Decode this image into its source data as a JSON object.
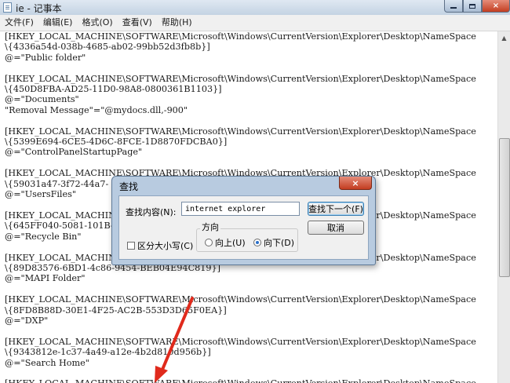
{
  "window": {
    "title": "ie - 记事本",
    "controls": {
      "minimize": "minimize",
      "maximize": "maximize",
      "close": "×"
    }
  },
  "menu": {
    "items": [
      "文件(F)",
      "编辑(E)",
      "格式(O)",
      "查看(V)",
      "帮助(H)"
    ]
  },
  "editor": {
    "lines": [
      "[HKEY_LOCAL_MACHINE\\SOFTWARE\\Microsoft\\Windows\\CurrentVersion\\Explorer\\Desktop\\NameSpace",
      "\\{4336a54d-038b-4685-ab02-99bb52d3fb8b}]",
      "@=\"Public folder\"",
      "",
      "[HKEY_LOCAL_MACHINE\\SOFTWARE\\Microsoft\\Windows\\CurrentVersion\\Explorer\\Desktop\\NameSpace",
      "\\{450D8FBA-AD25-11D0-98A8-0800361B1103}]",
      "@=\"Documents\"",
      "\"Removal Message\"=\"@mydocs.dll,-900\"",
      "",
      "[HKEY_LOCAL_MACHINE\\SOFTWARE\\Microsoft\\Windows\\CurrentVersion\\Explorer\\Desktop\\NameSpace",
      "\\{5399E694-6CE5-4D6C-8FCE-1D8870FDCBA0}]",
      "@=\"ControlPanelStartupPage\"",
      "",
      "[HKEY_LOCAL_MACHINE\\SOFTWARE\\Microsoft\\Windows\\CurrentVersion\\Explorer\\Desktop\\NameSpace",
      "\\{59031a47-3f72-44a7-",
      "@=\"UsersFiles\"",
      "",
      "[HKEY_LOCAL_MACHINE\\SOFTWARE\\Microsoft\\Windows\\CurrentVersion\\Explorer\\Desktop\\NameSpace",
      "\\{645FF040-5081-101B-",
      "@=\"Recycle Bin\"",
      "",
      "[HKEY_LOCAL_MACHINE\\SOFTWARE\\Microsoft\\Windows\\CurrentVersion\\Explorer\\Desktop\\NameSpace",
      "\\{89D83576-6BD1-4c86-9454-BEB04E94C819}]",
      "@=\"MAPI Folder\"",
      "",
      "[HKEY_LOCAL_MACHINE\\SOFTWARE\\Microsoft\\Windows\\CurrentVersion\\Explorer\\Desktop\\NameSpace",
      "\\{8FD8B88D-30E1-4F25-AC2B-553D3D65F0EA}]",
      "@=\"DXP\"",
      "",
      "[HKEY_LOCAL_MACHINE\\SOFTWARE\\Microsoft\\Windows\\CurrentVersion\\Explorer\\Desktop\\NameSpace",
      "\\{9343812e-1c37-4a49-a12e-4b2d810d956b}]",
      "@=\"Search Home\"",
      "",
      "[HKEY_LOCAL_MACHINE\\SOFTWARE\\Microsoft\\Windows\\CurrentVersion\\Explorer\\Desktop\\NameSpace"
    ]
  },
  "find_dialog": {
    "title": "查找",
    "close_label": "×",
    "find_label": "查找内容(N):",
    "find_value": "internet explorer",
    "find_next_label": "查找下一个(F)",
    "cancel_label": "取消",
    "direction_label": "方向",
    "direction_up_label": "向上(U)",
    "direction_down_label": "向下(D)",
    "direction_selected": "down",
    "match_case_label": "区分大小写(C)",
    "match_case_checked": false
  },
  "annotation": {
    "arrow_color": "#e02a1c"
  }
}
